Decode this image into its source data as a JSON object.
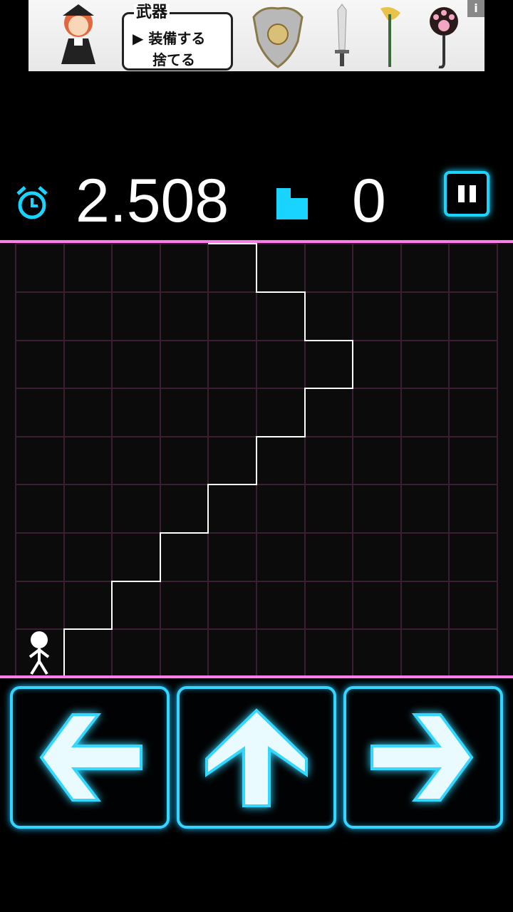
{
  "ad": {
    "menu_title": "武器",
    "menu_option_1": "▶ 装備する",
    "menu_option_2": "捨てる",
    "info_label": "i"
  },
  "hud": {
    "timer_value": "2.508",
    "steps_value": "0",
    "accent_color": "#19d4ff"
  },
  "field": {
    "grid_color": "#3a1f33",
    "border_color": "#ff7de9",
    "stair_color": "#ffffff"
  },
  "controls": {
    "left": "left-arrow-icon",
    "up": "up-arrow-icon",
    "right": "right-arrow-icon"
  }
}
